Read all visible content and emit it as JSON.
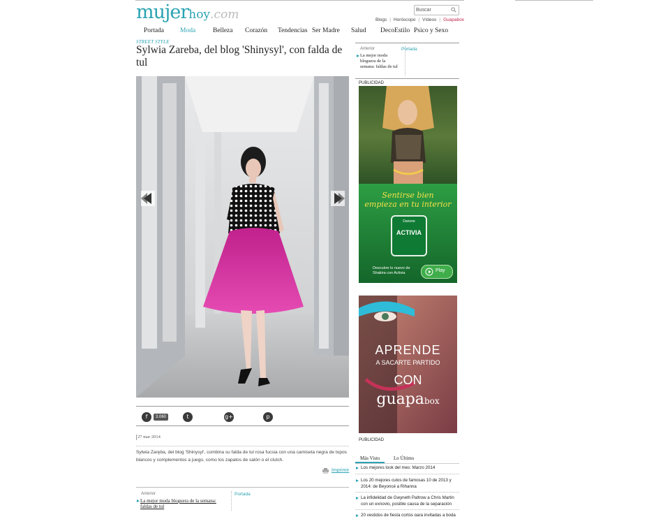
{
  "logo": {
    "part1": "mujer",
    "part2": "hoy",
    "part3": ".com"
  },
  "search": {
    "placeholder": "Buscar"
  },
  "top_links": [
    "Blogs",
    "Horóscopo",
    "Vídeos",
    "Guapabox"
  ],
  "nav": [
    {
      "label": "Portada"
    },
    {
      "label": "Moda",
      "active": true
    },
    {
      "label": "Belleza"
    },
    {
      "label": "Corazón"
    },
    {
      "label": "Tendencias"
    },
    {
      "label": "Ser Madre"
    },
    {
      "label": "Salud"
    },
    {
      "label": "DecoEstilo"
    },
    {
      "label": "Psico y Sexo"
    }
  ],
  "article": {
    "section": "STREET STYLE",
    "title": "Sylwia Zareba, del blog 'Shinysyl', con falda de tul",
    "share_count": "3.060",
    "date": "27 mar 2014",
    "body": "Sylwia Zaręba, del blog 'Shinysyl', combina su falda de tul rosa fucsia con una camiseta negra de topos blancos y complementos a juego, como los zapatos de salón o el clutch.",
    "print_label": "Imprimir"
  },
  "prev_top": {
    "label": "Anterior",
    "link": "La mejor moda bloguera de la semana: faldas de tul",
    "portada": "Portada"
  },
  "prev_bottom": {
    "label": "Anterior",
    "link": "La mejor moda bloguera de la semana: faldas de tul",
    "portada": "Portada"
  },
  "publicidad": "PUBLICIDAD",
  "ad1": {
    "tagline1": "Sentirse bien",
    "tagline2": "empieza en tu interior",
    "brand": "Danone",
    "product": "ACTIVIA",
    "cta1": "Descubre lo nuevo de",
    "cta2": "Shakira con Activia",
    "play": "Play"
  },
  "ad2": {
    "line1": "APRENDE",
    "line2": "A SACARTE PARTIDO",
    "line3": "CON",
    "brand1": "guapa",
    "brand2": "box"
  },
  "tabs": {
    "first": "Más Visto",
    "second": "Lo Último"
  },
  "most_viewed": [
    "Los mejores look del mes: Marzo 2014",
    "Los 20 mejores culos de famosas 10 de 2013 y 2014: de Beyoncé a Rihanna",
    "La infidelidad de Gwyneth Paltrow a Chris Martin con un exnovio, posible causa de la separación",
    "20 vestidos de fiesta cortos para invitadas a boda"
  ],
  "colors": {
    "accent": "#2ba3b3",
    "guapabox": "#c0234b",
    "skirt": "#d52da0",
    "activia_green": "#1f8a3a"
  }
}
